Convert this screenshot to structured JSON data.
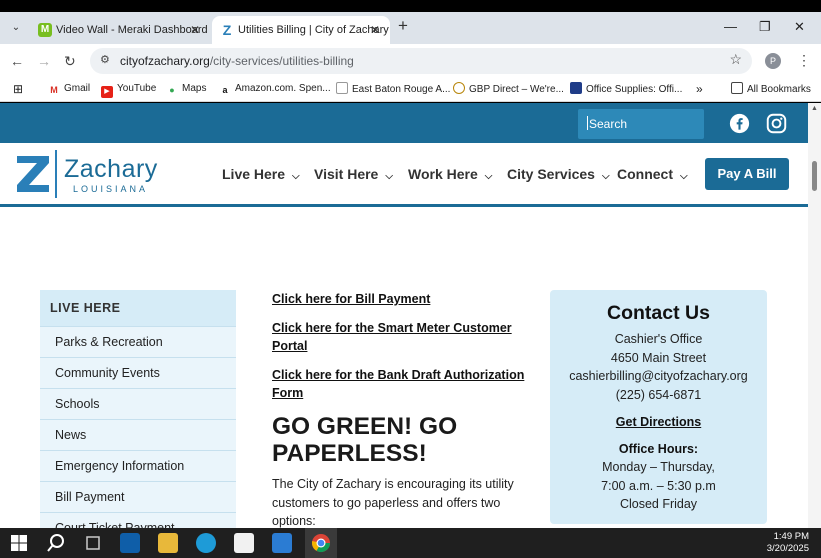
{
  "browser": {
    "tabs": [
      {
        "title": "Video Wall - Meraki Dashboard",
        "favicon": "M",
        "active": false
      },
      {
        "title": "Utilities Billing | City of Zachary",
        "favicon": "Z",
        "active": true
      }
    ],
    "url_domain": "cityofzachary.org",
    "url_path": "/city-services/utilities-billing",
    "profile_initial": "P",
    "bookmarks": [
      {
        "label": "Gmail",
        "icon": "gmail-icon"
      },
      {
        "label": "YouTube",
        "icon": "youtube-icon"
      },
      {
        "label": "Maps",
        "icon": "maps-icon"
      },
      {
        "label": "Amazon.com. Spen...",
        "icon": "amazon-icon"
      },
      {
        "label": "East Baton Rouge A...",
        "icon": "ebr-icon"
      },
      {
        "label": "GBP Direct – We're...",
        "icon": "gbp-icon"
      },
      {
        "label": "Office Supplies: Offi...",
        "icon": "office-icon"
      }
    ],
    "bookmarks_overflow": "»",
    "all_bookmarks": "All Bookmarks"
  },
  "site": {
    "search_placeholder": "Search",
    "logo_name": "Zachary",
    "logo_sub": "LOUISIANA",
    "nav": [
      "Live Here",
      "Visit Here",
      "Work Here",
      "City Services",
      "Connect"
    ],
    "pay_button": "Pay A Bill"
  },
  "sidebar": {
    "heading": "LIVE HERE",
    "items": [
      "Parks & Recreation",
      "Community Events",
      "Schools",
      "News",
      "Emergency Information",
      "Bill Payment",
      "Court Ticket Payment"
    ]
  },
  "main": {
    "links": [
      "Click here for Bill Payment",
      "Click here for the Smart Meter Customer Portal",
      "Click here for the Bank Draft Authorization Form"
    ],
    "heading": "GO GREEN! GO PAPERLESS!",
    "paragraph": "The City of Zachary is encouraging its utility customers to go paperless and offers two options:"
  },
  "contact": {
    "title": "Contact Us",
    "office": "Cashier's Office",
    "address": "4650 Main Street",
    "email": "cashierbilling@cityofzachary.org",
    "phone": "(225) 654-6871",
    "directions": "Get Directions",
    "hours_label": "Office Hours:",
    "hours_days": "Monday – Thursday,",
    "hours_time": "7:00 a.m. – 5:30 p.m",
    "closed": "Closed Friday"
  },
  "taskbar": {
    "time": "1:49 PM",
    "date": "3/20/2025"
  },
  "colors": {
    "brand_blue": "#1b6b96",
    "light_blue": "#d6ecf7"
  }
}
